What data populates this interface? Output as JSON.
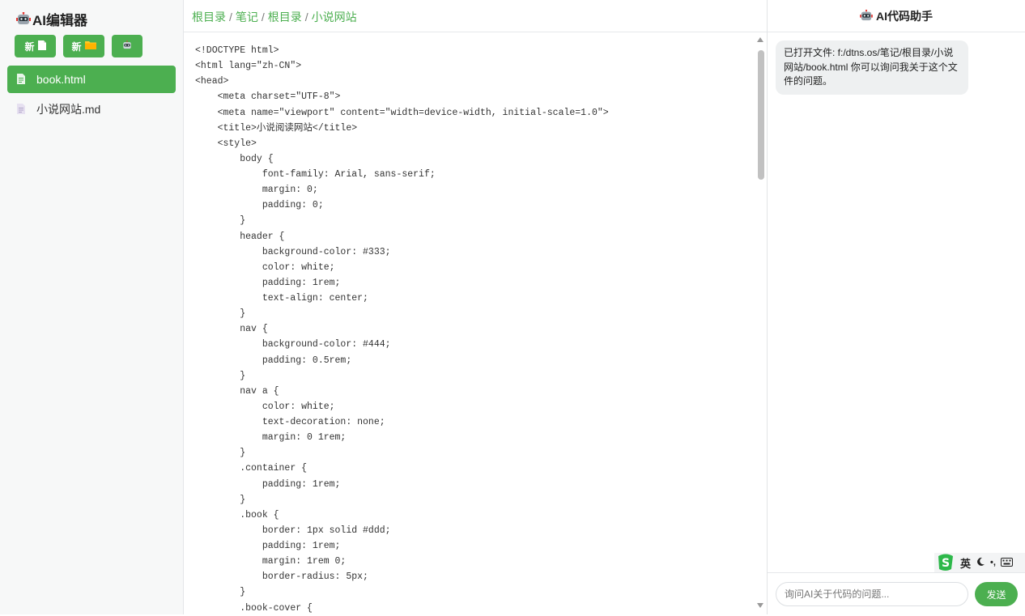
{
  "sidebar": {
    "app_title": "AI编辑器",
    "buttons": [
      {
        "label": "新",
        "icon": "file-icon"
      },
      {
        "label": "新",
        "icon": "folder-icon"
      },
      {
        "label": "",
        "icon": "robot-icon"
      }
    ],
    "files": [
      {
        "name": "book.html",
        "active": true
      },
      {
        "name": "小说网站.md",
        "active": false
      }
    ]
  },
  "editor": {
    "breadcrumb": [
      "根目录",
      "笔记",
      "根目录",
      "小说网站"
    ],
    "code_lines": [
      "<!DOCTYPE html>",
      "<html lang=\"zh-CN\">",
      "<head>",
      "    <meta charset=\"UTF-8\">",
      "    <meta name=\"viewport\" content=\"width=device-width, initial-scale=1.0\">",
      "    <title>小说阅读网站</title>",
      "    <style>",
      "        body {",
      "            font-family: Arial, sans-serif;",
      "            margin: 0;",
      "            padding: 0;",
      "        }",
      "        header {",
      "            background-color: #333;",
      "            color: white;",
      "            padding: 1rem;",
      "            text-align: center;",
      "        }",
      "        nav {",
      "            background-color: #444;",
      "            padding: 0.5rem;",
      "        }",
      "        nav a {",
      "            color: white;",
      "            text-decoration: none;",
      "            margin: 0 1rem;",
      "        }",
      "        .container {",
      "            padding: 1rem;",
      "        }",
      "        .book {",
      "            border: 1px solid #ddd;",
      "            padding: 1rem;",
      "            margin: 1rem 0;",
      "            border-radius: 5px;",
      "        }",
      "        .book-cover {"
    ]
  },
  "assistant": {
    "title": "AI代码助手",
    "message": "已打开文件: f:/dtns.os/笔记/根目录/小说网站/book.html 你可以询问我关于这个文件的问题。",
    "input_placeholder": "询问AI关于代码的问题...",
    "send_label": "发送"
  },
  "ime": {
    "lang": "英",
    "punct": "•,"
  },
  "colors": {
    "accent": "#4caf50",
    "sidebar_bg": "#f7f8f8",
    "bubble_bg": "#eef0f1"
  }
}
